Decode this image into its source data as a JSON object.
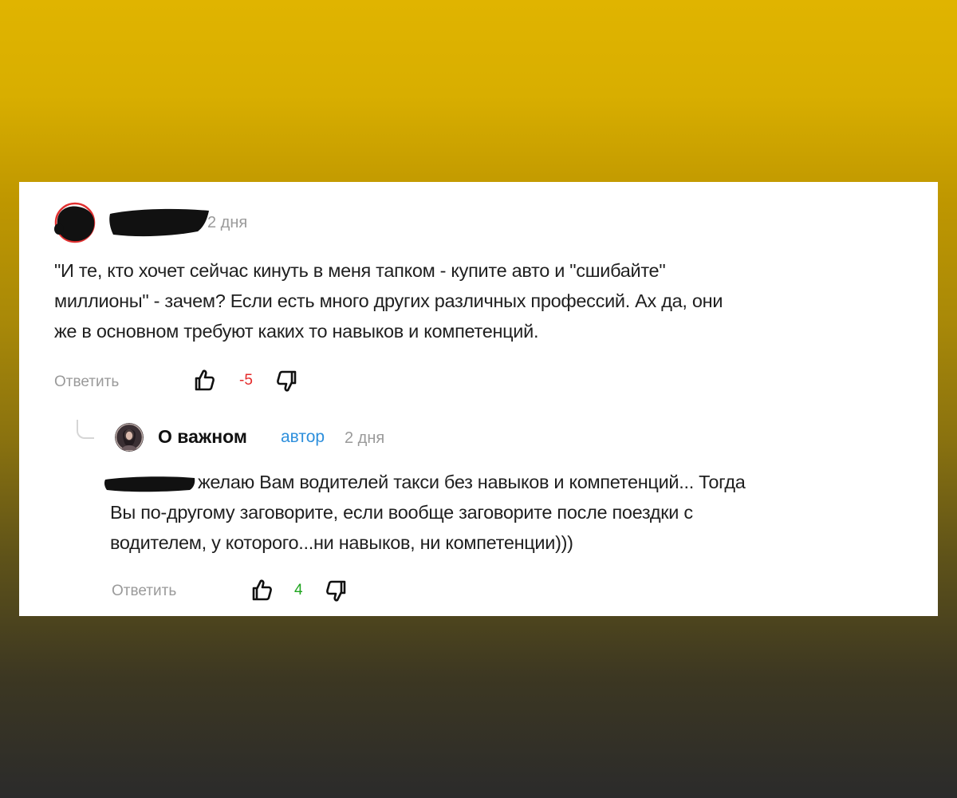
{
  "comment": {
    "time": "2 дня",
    "text_lines": [
      "\"И те, кто хочет сейчас кинуть в меня тапком - купите авто и \"сшибайте\"",
      "миллионы\" - зачем? Если есть много других различных профессий. Ах да, они",
      "же в основном требуют каких то навыков и компетенций."
    ],
    "reply_label": "Ответить",
    "score": "-5",
    "score_color": "#e52b2b"
  },
  "reply": {
    "author_name": "О важном",
    "author_badge": "автор",
    "time": "2 дня",
    "text_first_line": "желаю Вам водителей такси без навыков и компетенций... Тогда",
    "text_lines": [
      "Вы по-другому заговорите, если вообще заговорите после поездки с",
      "водителем, у которого...ни навыков, ни компетенции)))"
    ],
    "reply_label": "Ответить",
    "score": "4",
    "score_color": "#1fa51f"
  },
  "icons": {
    "like": "thumbs-up-icon",
    "dislike": "thumbs-down-icon"
  },
  "colors": {
    "badge": "#2d8fdc",
    "muted": "#9a9a9a"
  }
}
